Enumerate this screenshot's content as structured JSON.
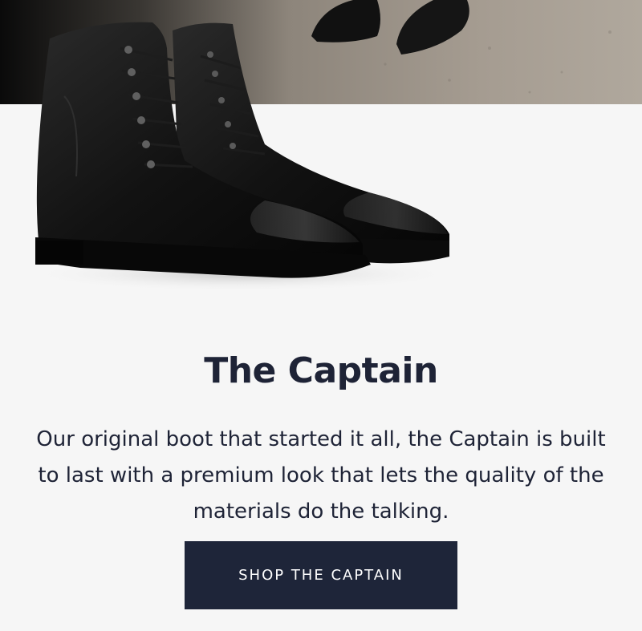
{
  "product": {
    "title": "The Captain",
    "description": "Our original boot that started it all, the Captain is built to last with a premium look that lets the quality of the materials do the talking.",
    "cta_label": "SHOP THE CAPTAIN"
  },
  "colors": {
    "background": "#f6f6f6",
    "text": "#1e2336",
    "button": "#1e2539",
    "button_text": "#ffffff"
  }
}
